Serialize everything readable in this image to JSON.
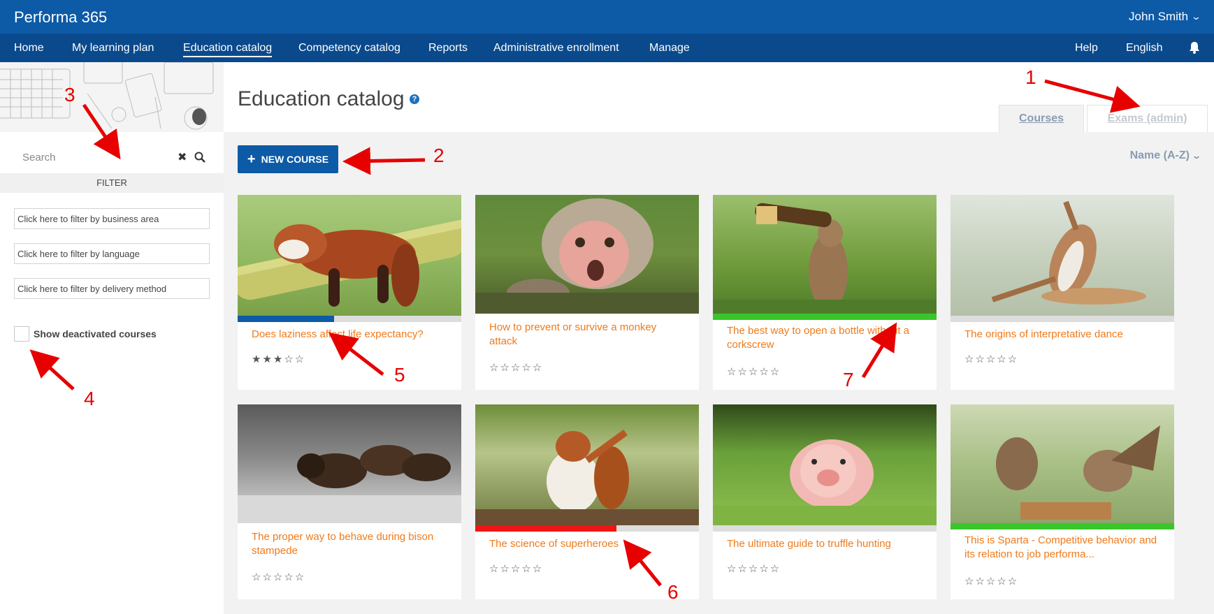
{
  "app": {
    "title": "Performa 365",
    "user": "John Smith"
  },
  "nav": {
    "items": [
      "Home",
      "My learning plan",
      "Education catalog",
      "Competency catalog",
      "Reports",
      "Administrative enrollment",
      "Manage"
    ],
    "help": "Help",
    "language": "English"
  },
  "sidebar": {
    "search_placeholder": "Search",
    "filter_label": "FILTER",
    "filter_business": "Click here to filter by business area",
    "filter_language": "Click here to filter by language",
    "filter_delivery": "Click here to filter by delivery method",
    "deactivated_label": "Show deactivated courses"
  },
  "main": {
    "title": "Education catalog",
    "tabs": [
      "Courses",
      "Exams (admin)"
    ],
    "new_course": "NEW COURSE",
    "sort": "Name (A-Z)"
  },
  "courses": [
    {
      "title": "Does laziness affect life expectancy?",
      "stars": "★★★☆☆",
      "progress_color": "#0d5aa7",
      "progress": 0.43,
      "image": "red-panda"
    },
    {
      "title": "How to prevent or survive a monkey attack",
      "stars": "☆☆☆☆☆",
      "progress_color": "",
      "progress": 0,
      "image": "monkey"
    },
    {
      "title": "The best way to open a bottle without a corkscrew",
      "stars": "☆☆☆☆☆",
      "progress_color": "#39c62a",
      "progress": 1.0,
      "image": "squirrel-bottle"
    },
    {
      "title": "The origins of interpretative dance",
      "stars": "☆☆☆☆☆",
      "progress_color": "",
      "progress": 0,
      "image": "squirrel-dance"
    },
    {
      "title": "The proper way to behave during bison stampede",
      "stars": "☆☆☆☆☆",
      "progress_color": "",
      "progress": 0,
      "image": "bison"
    },
    {
      "title": "The science of superheroes",
      "stars": "☆☆☆☆☆",
      "progress_color": "#f01414",
      "progress": 0.63,
      "image": "squirrel-hero"
    },
    {
      "title": "The ultimate guide to truffle hunting",
      "stars": "☆☆☆☆☆",
      "progress_color": "",
      "progress": 0,
      "image": "piglet"
    },
    {
      "title": "This is Sparta - Competitive behavior and its relation to job performa...",
      "stars": "☆☆☆☆☆",
      "progress_color": "#39c62a",
      "progress": 1.0,
      "image": "sparrows"
    }
  ],
  "annotations": [
    "1",
    "2",
    "3",
    "4",
    "5",
    "6",
    "7"
  ],
  "colors": {
    "brand": "#0d5aa7",
    "accent": "#f07a1a",
    "annotation": "#e60000"
  }
}
